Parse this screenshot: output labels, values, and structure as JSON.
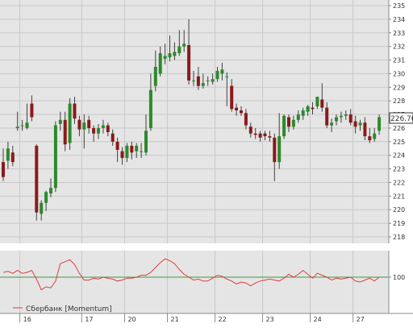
{
  "colors": {
    "background": "#ffffff",
    "plot_background": "#e5e5e5",
    "grid": "#c8c8c8",
    "axis": "#8c8c8c",
    "up_candle": "#2b8a2b",
    "down_candle": "#8b1a1a",
    "wick": "#404040",
    "momentum_line": "#d94040",
    "momentum_ref_line": "#3a9a3a",
    "last_price_box_border": "#333333",
    "text": "#333333"
  },
  "price_axis": {
    "tick_labels": [
      "218",
      "219",
      "220",
      "221",
      "222",
      "223",
      "224",
      "225",
      "226",
      "227",
      "228",
      "229",
      "230",
      "231",
      "232",
      "233",
      "234",
      "235"
    ],
    "last_price_label": "226.76"
  },
  "momentum_axis": {
    "tick_labels": [
      "100"
    ]
  },
  "time_axis": {
    "tick_labels": [
      "16",
      "17",
      "20",
      "21",
      "22",
      "23",
      "24",
      "27"
    ]
  },
  "legend": {
    "label": "Сбербанк [Momentum]"
  },
  "chart_data": [
    {
      "type": "candlestick",
      "x": [
        0,
        1,
        2,
        3,
        4,
        5,
        6,
        7,
        8,
        9,
        10,
        11,
        12,
        13,
        14,
        15,
        16,
        17,
        18,
        19,
        20,
        21,
        22,
        23,
        24,
        25,
        26,
        27,
        28,
        29,
        30,
        31,
        32,
        33,
        34,
        35,
        36,
        37,
        38,
        39,
        40,
        41,
        42,
        43,
        44,
        45,
        46,
        47,
        48,
        49,
        50,
        51,
        52,
        53,
        54,
        55,
        56,
        57,
        58,
        59,
        60,
        61,
        62,
        63,
        64,
        65,
        66,
        67,
        68,
        69,
        70,
        71,
        72,
        73,
        74,
        75,
        76,
        77,
        78,
        79
      ],
      "open": [
        223.5,
        223.6,
        224.2,
        226.0,
        226.2,
        226.0,
        227.8,
        224.7,
        219.7,
        220.5,
        221.2,
        221.6,
        226.3,
        226.6,
        224.9,
        227.8,
        226.6,
        225.9,
        226.6,
        226.0,
        225.6,
        226.0,
        226.2,
        225.6,
        225.0,
        224.3,
        223.8,
        224.7,
        224.3,
        224.3,
        224.2,
        226.0,
        229.1,
        230.0,
        231.1,
        231.2,
        231.3,
        231.5,
        232.0,
        232.1,
        229.5,
        229.8,
        229.1,
        229.5,
        229.4,
        229.6,
        230.0,
        229.8,
        229.1,
        227.5,
        227.3,
        227.1,
        226.1,
        225.6,
        225.6,
        225.6,
        225.4,
        225.3,
        223.5,
        225.4,
        226.8,
        226.1,
        226.6,
        226.9,
        227.2,
        227.5,
        227.6,
        228.1,
        227.5,
        226.2,
        226.5,
        226.8,
        226.9,
        227.0,
        226.5,
        226.2,
        226.4,
        225.4,
        225.2,
        225.8
      ],
      "close": [
        222.4,
        224.5,
        223.5,
        226.1,
        226.2,
        226.4,
        226.8,
        219.8,
        220.5,
        221.3,
        221.6,
        226.2,
        226.6,
        224.8,
        227.8,
        226.7,
        225.9,
        226.4,
        226.0,
        225.6,
        226.0,
        226.2,
        225.7,
        225.0,
        224.4,
        223.8,
        224.7,
        224.2,
        224.7,
        224.3,
        225.8,
        228.8,
        230.5,
        231.5,
        231.3,
        231.5,
        231.6,
        232.0,
        232.2,
        229.5,
        229.5,
        229.1,
        229.3,
        229.5,
        229.6,
        230.2,
        230.3,
        229.8,
        227.4,
        227.3,
        227.1,
        226.2,
        225.6,
        225.5,
        225.3,
        225.4,
        225.3,
        223.5,
        225.4,
        226.9,
        226.1,
        226.6,
        227.0,
        227.3,
        227.6,
        227.4,
        228.3,
        227.5,
        226.2,
        226.4,
        226.8,
        226.9,
        227.0,
        226.4,
        226.1,
        226.4,
        225.4,
        225.1,
        225.6,
        226.8
      ],
      "high": [
        224.5,
        225.0,
        224.7,
        227.2,
        226.6,
        227.8,
        228.4,
        224.8,
        220.7,
        221.4,
        222.3,
        226.5,
        227.2,
        227.2,
        228.2,
        228.3,
        226.9,
        227.0,
        226.9,
        226.2,
        226.3,
        226.6,
        226.4,
        225.9,
        225.3,
        224.6,
        224.9,
        225.0,
        224.9,
        224.9,
        227.0,
        230.0,
        231.7,
        232.0,
        232.2,
        232.8,
        232.3,
        233.2,
        233.2,
        234.0,
        230.2,
        230.5,
        230.0,
        229.8,
        230.0,
        230.5,
        230.8,
        230.1,
        229.6,
        227.8,
        227.6,
        227.4,
        226.4,
        226.0,
        225.8,
        225.8,
        225.8,
        225.6,
        227.1,
        227.0,
        227.0,
        226.9,
        227.3,
        227.5,
        227.7,
        227.9,
        228.3,
        229.3,
        227.9,
        226.7,
        227.0,
        227.2,
        227.3,
        227.4,
        226.9,
        226.6,
        226.8,
        226.0,
        226.0,
        227.0
      ],
      "low": [
        222.1,
        223.0,
        223.2,
        225.8,
        225.8,
        225.9,
        226.5,
        219.2,
        219.2,
        219.9,
        220.9,
        221.3,
        225.8,
        224.3,
        224.4,
        226.3,
        225.4,
        224.5,
        225.6,
        225.0,
        225.2,
        225.6,
        225.4,
        224.7,
        223.5,
        223.3,
        223.5,
        223.7,
        223.8,
        223.8,
        224.0,
        225.8,
        228.7,
        229.8,
        230.7,
        230.9,
        231.0,
        231.3,
        231.6,
        229.2,
        229.1,
        228.8,
        228.9,
        229.1,
        229.2,
        229.4,
        229.5,
        227.6,
        227.2,
        226.9,
        226.9,
        225.9,
        225.3,
        225.2,
        225.0,
        225.1,
        225.0,
        222.1,
        223.0,
        225.2,
        225.7,
        225.9,
        226.4,
        226.6,
        226.9,
        227.0,
        227.4,
        227.2,
        226.0,
        225.7,
        226.2,
        226.4,
        226.6,
        226.2,
        225.6,
        225.8,
        225.1,
        224.9,
        225.0,
        225.5
      ]
    },
    {
      "type": "line",
      "series": [
        {
          "name": "Сбербанк [Momentum]",
          "values": [
            100.5,
            100.6,
            100.4,
            100.7,
            100.4,
            100.5,
            100.7,
            99.8,
            98.7,
            99.0,
            98.9,
            99.6,
            101.4,
            101.6,
            101.8,
            101.3,
            100.4,
            99.7,
            99.7,
            99.9,
            99.8,
            100.0,
            99.9,
            99.8,
            99.6,
            99.7,
            99.9,
            99.9,
            100.0,
            100.2,
            100.2,
            100.5,
            101.0,
            101.5,
            101.9,
            101.7,
            101.4,
            100.8,
            100.3,
            100.0,
            99.7,
            99.8,
            99.6,
            99.6,
            99.9,
            100.2,
            100.1,
            99.8,
            99.6,
            99.3,
            99.5,
            99.4,
            99.1,
            99.4,
            99.6,
            99.7,
            99.8,
            99.7,
            99.6,
            99.9,
            100.3,
            100.0,
            100.3,
            100.7,
            100.3,
            99.9,
            100.4,
            100.2,
            100.0,
            99.7,
            99.9,
            99.8,
            99.9,
            100.0,
            99.6,
            99.5,
            99.7,
            99.9,
            99.6,
            100.0
          ]
        }
      ],
      "reference_line": 100
    }
  ]
}
